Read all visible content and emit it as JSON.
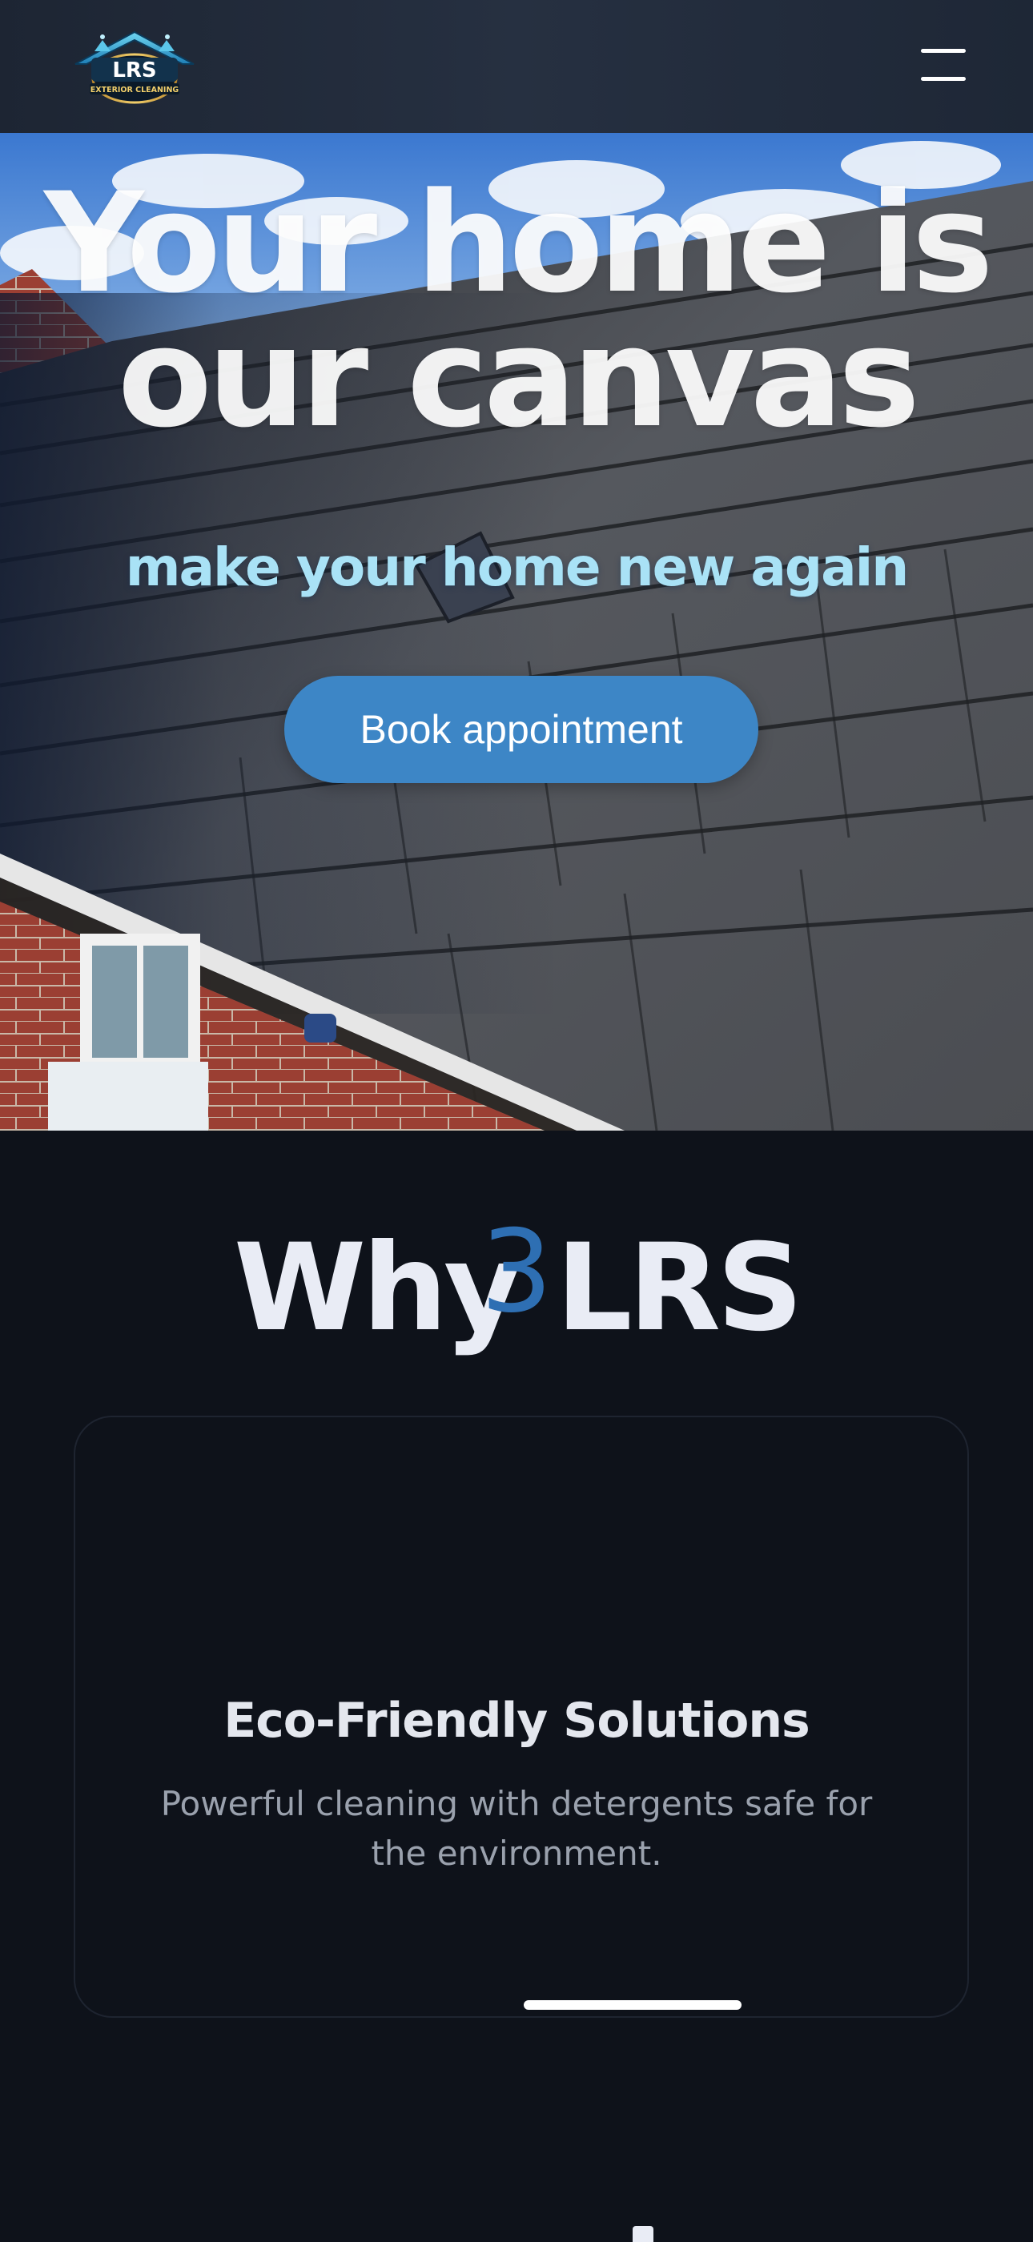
{
  "header": {
    "logo": {
      "brand": "LRS",
      "tagline": "EXTERIOR CLEANING"
    },
    "menu_icon": "hamburger-menu-icon"
  },
  "hero": {
    "title_line1": "Your home is",
    "title_line2": "our canvas",
    "subtitle": "make your home new again",
    "cta_label": "Book appointment",
    "background_image": "roof-tiles-photo"
  },
  "why": {
    "title": "Why LRS",
    "card": {
      "number": "3",
      "heading": "Eco-Friendly Solutions",
      "text": "Powerful cleaning with detergents safe for the environment."
    }
  },
  "colors": {
    "header_bg": "#1d2533",
    "page_bg": "#0e121a",
    "accent_blue": "#3d86c6",
    "number_blue": "#2e6fb3",
    "subtitle_cyan": "#a9e2f6"
  }
}
